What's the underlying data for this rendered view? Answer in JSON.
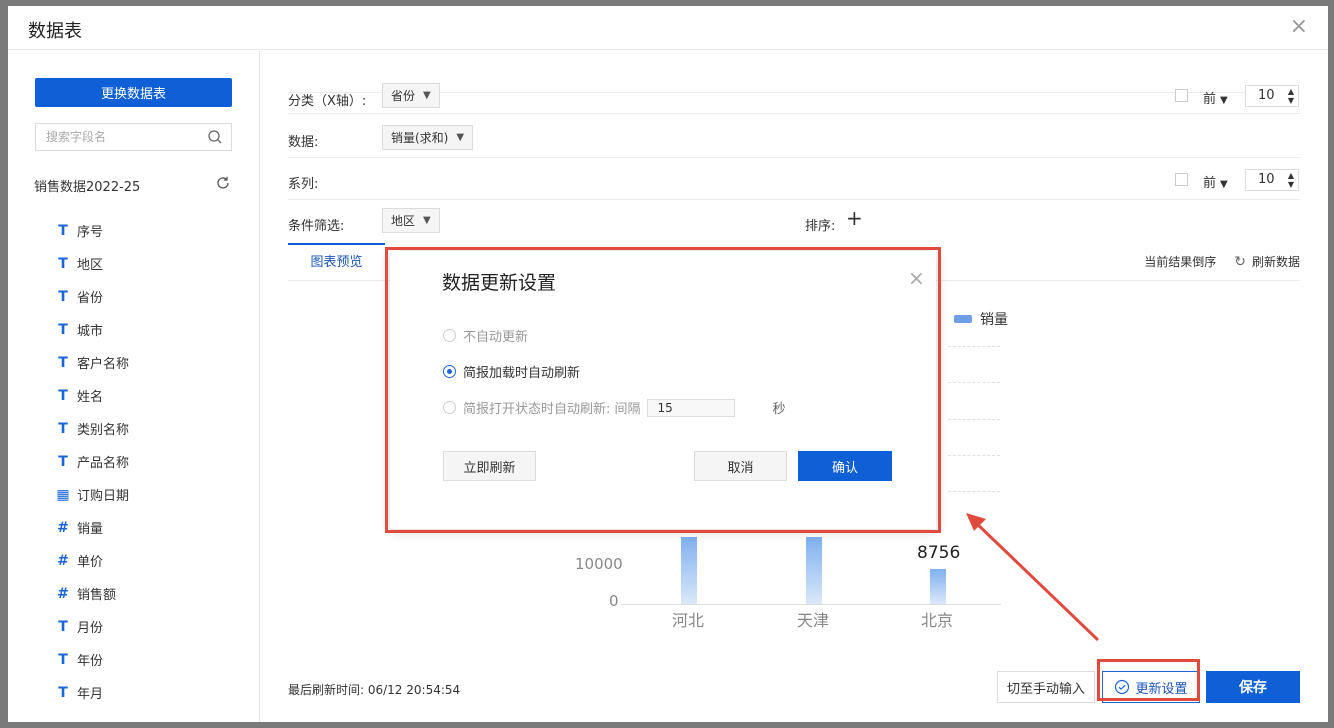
{
  "dialog": {
    "title": "数据表",
    "close": "×"
  },
  "left": {
    "change_button": "更换数据表",
    "search_placeholder": "搜索字段名",
    "dataset_name": "销售数据2022-25",
    "fields": [
      {
        "label": "序号",
        "type": "text",
        "icon": "T"
      },
      {
        "label": "地区",
        "type": "text",
        "icon": "T"
      },
      {
        "label": "省份",
        "type": "text",
        "icon": "T"
      },
      {
        "label": "城市",
        "type": "text",
        "icon": "T"
      },
      {
        "label": "客户名称",
        "type": "text",
        "icon": "T"
      },
      {
        "label": "姓名",
        "type": "text",
        "icon": "T"
      },
      {
        "label": "类别名称",
        "type": "text",
        "icon": "T"
      },
      {
        "label": "产品名称",
        "type": "text",
        "icon": "T"
      },
      {
        "label": "订购日期",
        "type": "date",
        "icon": "▦"
      },
      {
        "label": "销量",
        "type": "number",
        "icon": "#"
      },
      {
        "label": "单价",
        "type": "number",
        "icon": "#"
      },
      {
        "label": "销售额",
        "type": "number",
        "icon": "#"
      },
      {
        "label": "月份",
        "type": "text",
        "icon": "T"
      },
      {
        "label": "年份",
        "type": "text",
        "icon": "T"
      },
      {
        "label": "年月",
        "type": "text",
        "icon": "T"
      }
    ]
  },
  "config": {
    "category_label": "分类（X轴）:",
    "category_value": "省份",
    "data_label": "数据:",
    "data_value": "销量(求和)",
    "series_label": "系列:",
    "filter_label": "条件筛选:",
    "filter_value": "地区",
    "sort_label": "排序:",
    "sort_add": "+",
    "top_label": "前",
    "top_value_1": "10",
    "top_value_2": "10"
  },
  "preview": {
    "tab": "图表预览",
    "reverse": "当前结果倒序",
    "refresh": "刷新数据",
    "legend": "销量"
  },
  "chart_data": {
    "type": "bar",
    "categories": [
      "河北",
      "天津",
      "北京"
    ],
    "series": [
      {
        "name": "销量",
        "values": [
          null,
          null,
          8756
        ]
      }
    ],
    "y_ticks": [
      "0",
      "10000"
    ],
    "data_labels": [
      "8756"
    ]
  },
  "footer": {
    "last_refresh": "最后刷新时间: 06/12 20:54:54",
    "manual_input": "切至手动输入",
    "update_settings": "更新设置",
    "save": "保存"
  },
  "modal": {
    "title": "数据更新设置",
    "close": "×",
    "option_no_auto": "不自动更新",
    "option_on_load": "简报加载时自动刷新",
    "option_on_open": "简报打开状态时自动刷新: 间隔",
    "interval_value": "15",
    "interval_unit": "秒",
    "refresh_now": "立即刷新",
    "cancel": "取消",
    "confirm": "确认"
  },
  "colors": {
    "primary": "#0f5fd7",
    "highlight": "#e04a3f",
    "bar": "#7fb0ee"
  }
}
